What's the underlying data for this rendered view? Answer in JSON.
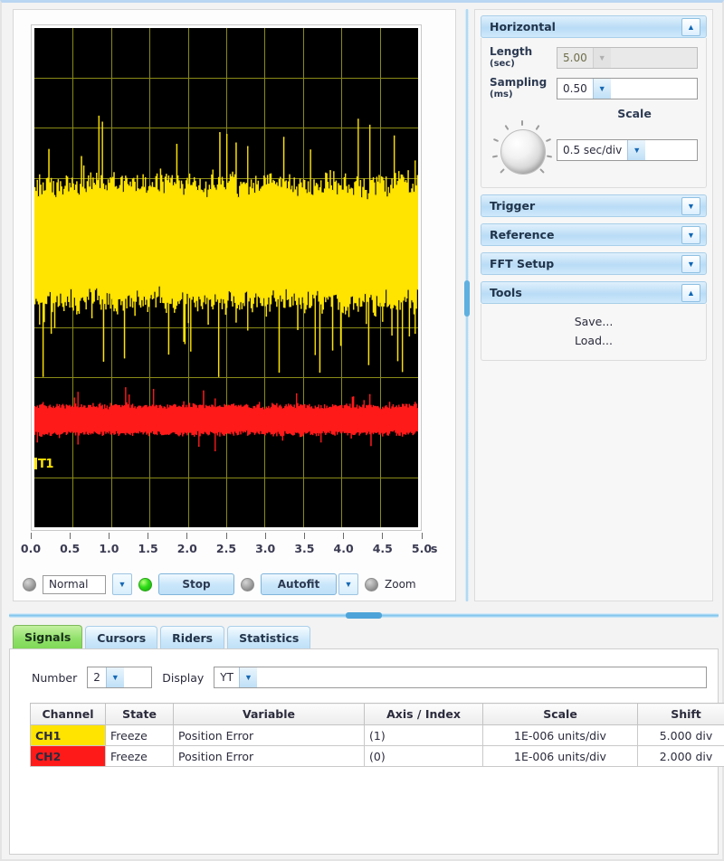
{
  "scope": {
    "x_axis": {
      "unit": "s",
      "ticks": [
        "0.0",
        "0.5",
        "1.0",
        "1.5",
        "2.0",
        "2.5",
        "3.0",
        "3.5",
        "4.0",
        "4.5",
        "5.0"
      ],
      "min": 0.0,
      "max": 5.0
    },
    "channel_marker": "T1",
    "grid_color": "#8a8a18",
    "background_color": "#000000",
    "ch1_color": "#ffe400",
    "ch2_color": "#ff1a1a"
  },
  "controls": {
    "mode": "Normal",
    "run_state_label": "Stop",
    "autofit_label": "Autofit",
    "zoom_label": "Zoom",
    "leds": [
      "off",
      "on",
      "off",
      "off"
    ]
  },
  "side_panels": {
    "horizontal": {
      "title": "Horizontal",
      "expanded": true,
      "length_label": "Length",
      "length_unit": "(sec)",
      "length_value": "5.00",
      "sampling_label": "Sampling",
      "sampling_unit": "(ms)",
      "sampling_value": "0.50",
      "scale_label": "Scale",
      "scale_value": "0.5 sec/div"
    },
    "trigger": {
      "title": "Trigger",
      "expanded": false
    },
    "reference": {
      "title": "Reference",
      "expanded": false
    },
    "fft_setup": {
      "title": "FFT Setup",
      "expanded": false
    },
    "tools": {
      "title": "Tools",
      "expanded": true,
      "items": [
        "Save...",
        "Load..."
      ]
    }
  },
  "bottom": {
    "tabs": [
      {
        "label": "Signals",
        "active": true
      },
      {
        "label": "Cursors",
        "active": false
      },
      {
        "label": "Riders",
        "active": false
      },
      {
        "label": "Statistics",
        "active": false
      }
    ],
    "number_label": "Number",
    "number_value": "2",
    "display_label": "Display",
    "display_value": "YT",
    "table": {
      "headers": [
        "Channel",
        "State",
        "Variable",
        "Axis / Index",
        "Scale",
        "Shift"
      ],
      "rows": [
        {
          "channel": "CH1",
          "channel_color": "#ffe400",
          "state": "Freeze",
          "variable": "Position Error",
          "axis_index": "(1)",
          "scale": "1E-006 units/div",
          "shift": "5.000 div"
        },
        {
          "channel": "CH2",
          "channel_color": "#ff1a1a",
          "state": "Freeze",
          "variable": "Position Error",
          "axis_index": "(0)",
          "scale": "1E-006 units/div",
          "shift": "2.000 div"
        }
      ]
    }
  },
  "chart_data": {
    "type": "line",
    "title": "",
    "xlabel": "s",
    "ylabel": "",
    "xlim": [
      0.0,
      5.0
    ],
    "grid": true,
    "x_ticks": [
      0.0,
      0.5,
      1.0,
      1.5,
      2.0,
      2.5,
      3.0,
      3.5,
      4.0,
      4.5,
      5.0
    ],
    "divisions": {
      "horizontal": 10,
      "vertical": 10
    },
    "series": [
      {
        "name": "CH1",
        "color": "#ffe400",
        "description": "Dense random noise band, thick, centered near 4.2 divisions from top",
        "band_center_div": 4.3,
        "band_halfwidth_div": 1.25,
        "scale": "1E-006 units/div",
        "shift": "5.000 div"
      },
      {
        "name": "CH2",
        "color": "#ff1a1a",
        "description": "Dense random noise band, thin, centered near 7.8 divisions from top",
        "band_center_div": 7.85,
        "band_halfwidth_div": 0.28,
        "scale": "1E-006 units/div",
        "shift": "2.000 div"
      }
    ]
  }
}
